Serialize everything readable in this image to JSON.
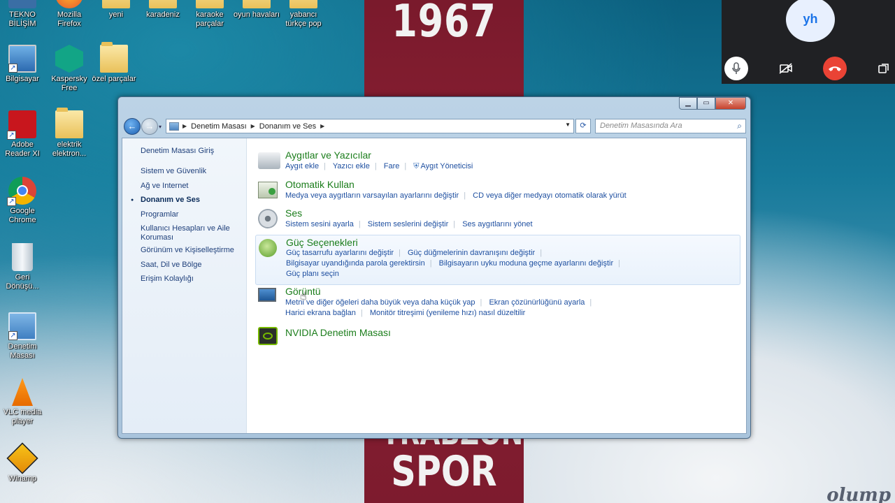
{
  "wallpaper": {
    "top_text": "1967",
    "mid_text": "TRABZON",
    "bottom_text": "SPOR",
    "watermark": "olump"
  },
  "desktop_icons": [
    {
      "label": "TEKNO BİLİŞİM",
      "icon": "app-icon"
    },
    {
      "label": "Mozilla Firefox",
      "icon": "firefox-icon"
    },
    {
      "label": "yeni",
      "icon": "folder-icon"
    },
    {
      "label": "karadeniz",
      "icon": "folder-icon"
    },
    {
      "label": "karaoke parçalar",
      "icon": "folder-icon"
    },
    {
      "label": "oyun havaları",
      "icon": "folder-icon"
    },
    {
      "label": "yabancı türkçe pop",
      "icon": "folder-icon"
    },
    {
      "label": "Bilgisayar",
      "icon": "computer-icon"
    },
    {
      "label": "Kaspersky Free",
      "icon": "kaspersky-icon"
    },
    {
      "label": "özel parçalar",
      "icon": "folder-icon"
    },
    {
      "label": "Adobe Reader XI",
      "icon": "pdf-icon"
    },
    {
      "label": "elektrik elektron...",
      "icon": "folder-icon"
    },
    {
      "label": "Google Chrome",
      "icon": "chrome-icon"
    },
    {
      "label": "Geri Dönüşü...",
      "icon": "recycle-bin-icon"
    },
    {
      "label": "Denetim Masası",
      "icon": "control-panel-icon"
    },
    {
      "label": "VLC media player",
      "icon": "vlc-icon"
    },
    {
      "label": "Winamp",
      "icon": "winamp-icon"
    }
  ],
  "call": {
    "avatar_initials": "yh"
  },
  "window": {
    "breadcrumb": [
      "Denetim Masası",
      "Donanım ve Ses"
    ],
    "search_placeholder": "Denetim Masasında Ara",
    "sidebar": {
      "home": "Denetim Masası Giriş",
      "items": [
        {
          "label": "Sistem ve Güvenlik",
          "active": false
        },
        {
          "label": "Ağ ve Internet",
          "active": false
        },
        {
          "label": "Donanım ve Ses",
          "active": true
        },
        {
          "label": "Programlar",
          "active": false
        },
        {
          "label": "Kullanıcı Hesapları ve Aile Koruması",
          "active": false
        },
        {
          "label": "Görünüm ve Kişiselleştirme",
          "active": false
        },
        {
          "label": "Saat, Dil ve Bölge",
          "active": false
        },
        {
          "label": "Erişim Kolaylığı",
          "active": false
        }
      ]
    },
    "categories": [
      {
        "title": "Aygıtlar ve Yazıcılar",
        "links": [
          "Aygıt ekle",
          "Yazıcı ekle",
          "Fare",
          "Aygıt Yöneticisi"
        ]
      },
      {
        "title": "Otomatik Kullan",
        "links": [
          "Medya veya aygıtların varsayılan ayarlarını değiştir",
          "CD veya diğer medyayı otomatik olarak yürüt"
        ]
      },
      {
        "title": "Ses",
        "links": [
          "Sistem sesini ayarla",
          "Sistem seslerini değiştir",
          "Ses aygıtlarını yönet"
        ]
      },
      {
        "title": "Güç Seçenekleri",
        "links_row1": [
          "Güç tasarrufu ayarlarını değiştir",
          "Güç düğmelerinin davranışını değiştir"
        ],
        "links_row2": [
          "Bilgisayar uyandığında parola gerektirsin",
          "Bilgisayarın uyku moduna geçme ayarlarını değiştir"
        ],
        "links_row3": [
          "Güç planı seçin"
        ]
      },
      {
        "title": "Görüntü",
        "links_row1": [
          "Metni ve diğer öğeleri daha büyük veya daha küçük yap",
          "Ekran çözünürlüğünü ayarla"
        ],
        "links_row2": [
          "Harici ekrana bağlan",
          "Monitör titreşimi (yenileme hızı) nasıl düzeltilir"
        ]
      },
      {
        "title": "NVIDIA Denetim Masası"
      }
    ]
  }
}
